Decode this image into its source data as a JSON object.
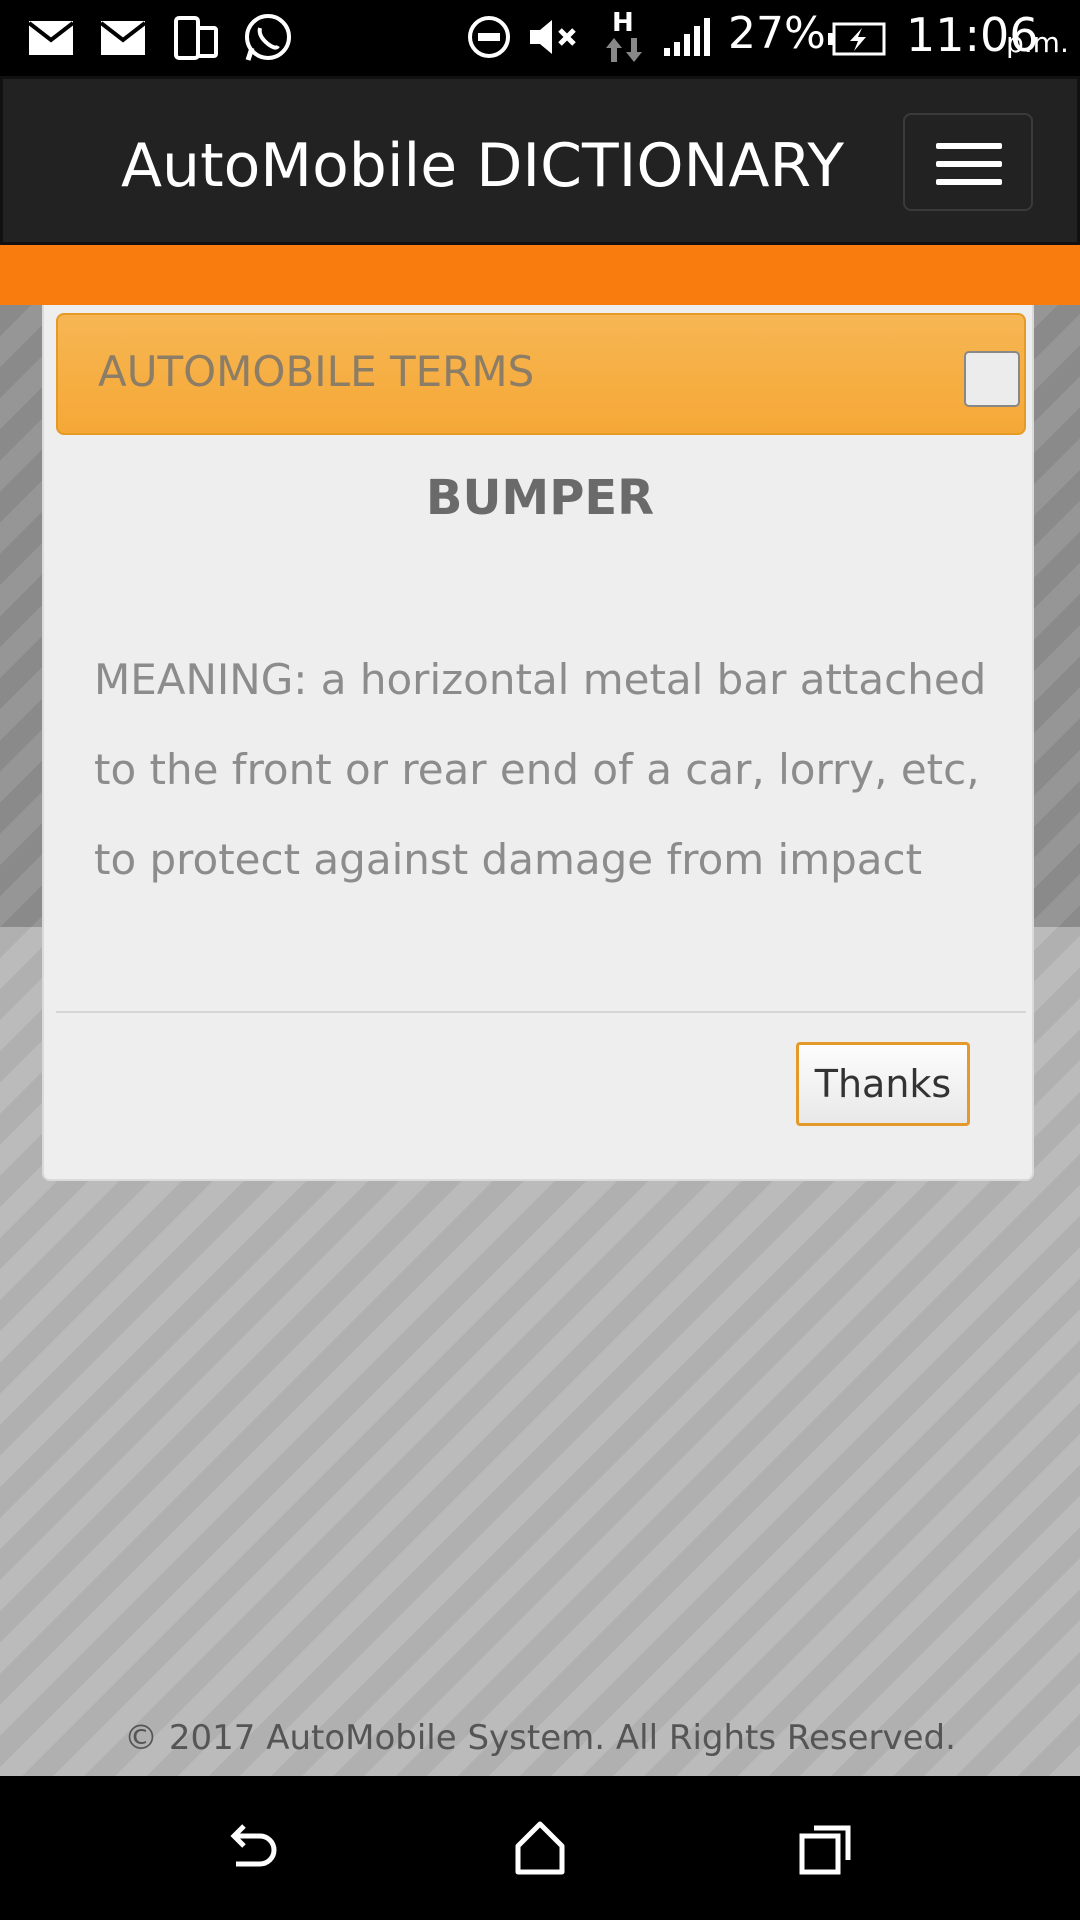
{
  "status_bar": {
    "battery": "27%",
    "time": "11:06",
    "ampm": "p.m.",
    "network": "H",
    "icons": [
      "mail-icon",
      "mail-icon",
      "phone-sync-icon",
      "whatsapp-icon",
      "dnd-icon",
      "mute-icon",
      "data-arrows-icon",
      "signal-icon",
      "battery-charging-icon"
    ]
  },
  "header": {
    "title": "AutoMobile DICTIONARY",
    "menu_icon": "hamburger-menu-icon"
  },
  "colors": {
    "accent": "#f87d0e",
    "modal_header": "#f5a836",
    "header_bg": "#222222"
  },
  "modal": {
    "header_title": "AUTOMOBILE TERMS",
    "term": "BUMPER",
    "meaning": "MEANING: a horizontal metal bar attached to the front or rear end of a car, lorry, etc, to protect against damage from impact",
    "button_label": "Thanks"
  },
  "footer": {
    "text": "© 2017 AutoMobile System. All Rights Reserved."
  },
  "nav_bar": {
    "icons": [
      "back-icon",
      "home-icon",
      "recents-icon"
    ]
  }
}
